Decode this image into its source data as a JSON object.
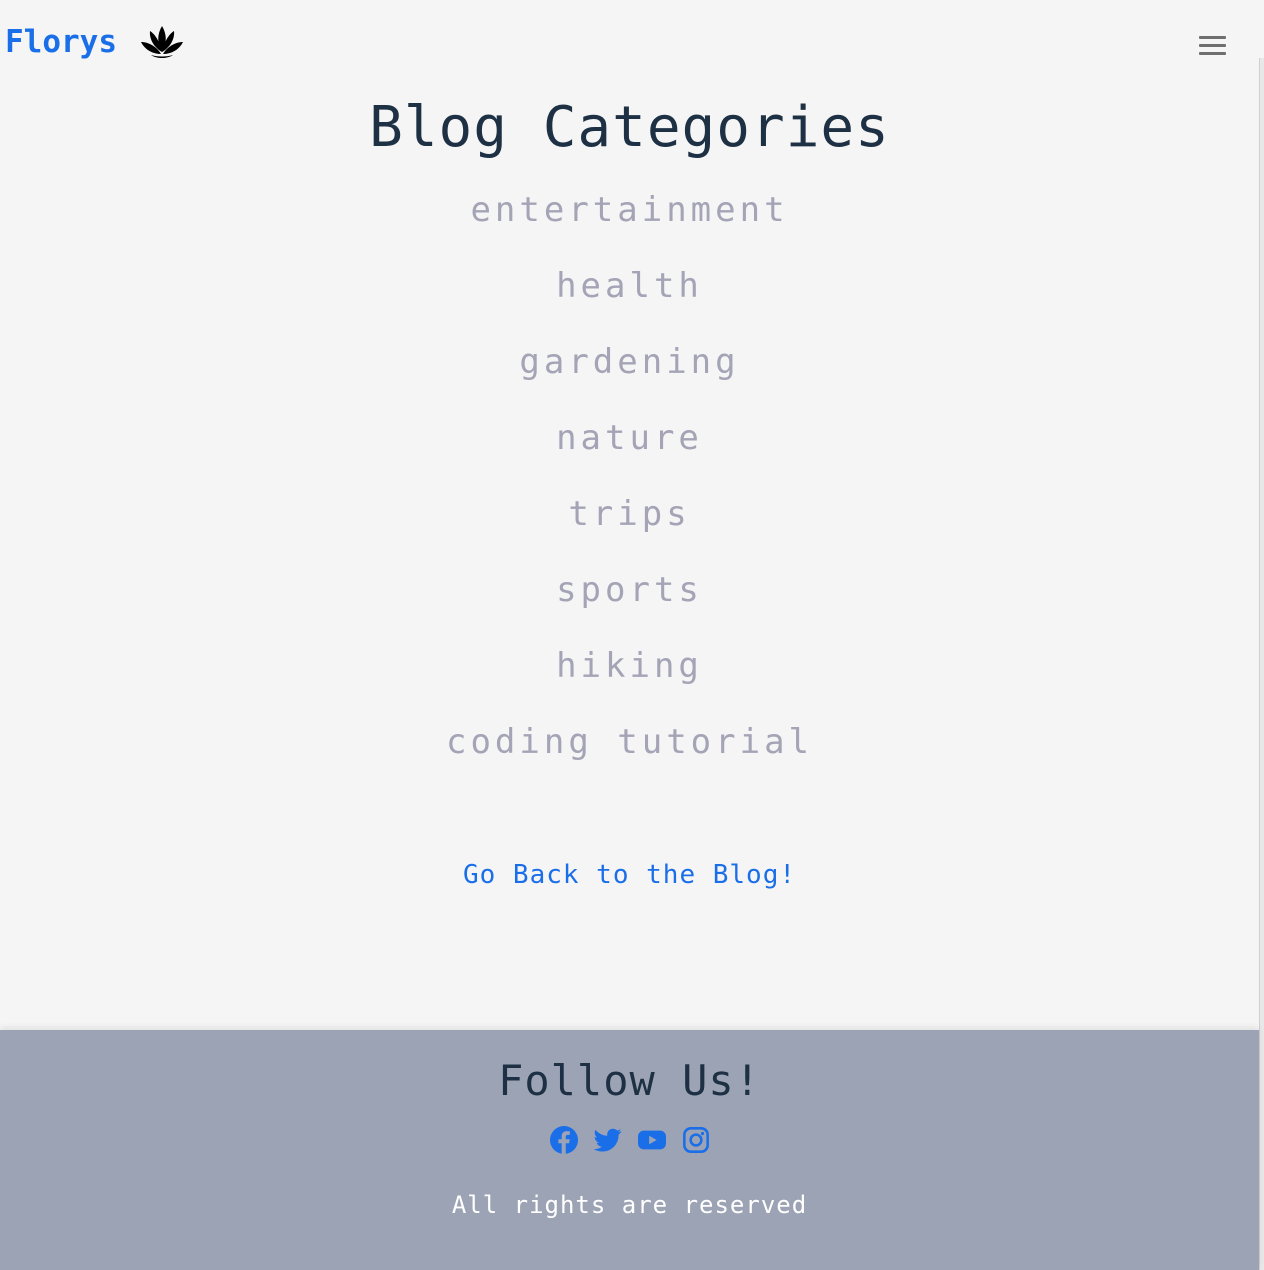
{
  "navbar": {
    "brand": "Florys",
    "logo_icon": "lotus-icon",
    "menu_icon": "hamburger-menu-icon"
  },
  "main": {
    "title": "Blog Categories",
    "categories": [
      "entertainment",
      "health",
      "gardening",
      "nature",
      "trips",
      "sports",
      "hiking",
      "coding tutorial"
    ],
    "back_link": "Go Back to the Blog!"
  },
  "footer": {
    "title": "Follow Us!",
    "social_icons": [
      "facebook-icon",
      "twitter-icon",
      "youtube-icon",
      "instagram-icon"
    ],
    "copyright": "All rights are reserved"
  },
  "colors": {
    "accent": "#1a6fe8",
    "heading": "#1e3044",
    "category_text": "#a4a4b6",
    "footer_bg": "#9ca3b5",
    "page_bg": "#f5f5f5"
  }
}
